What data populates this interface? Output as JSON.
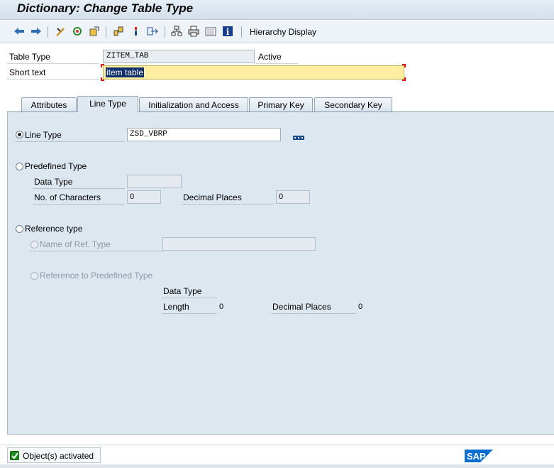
{
  "window": {
    "title": "Dictionary: Change Table Type"
  },
  "toolbar": {
    "icons": [
      "back-icon",
      "forward-icon",
      "display-change-icon",
      "activate-icon",
      "other-object-icon",
      "check-icon",
      "where-used-icon",
      "navigate-icon",
      "hierarchy-tree-icon",
      "print-icon",
      "list-icon",
      "info-icon"
    ],
    "hierarchy_display_label": "Hierarchy Display"
  },
  "header": {
    "table_type_label": "Table Type",
    "table_type_value": "ZITEM_TAB",
    "status": "Active",
    "short_text_label": "Short text",
    "short_text_value": "item table"
  },
  "tabs": [
    {
      "label": "Attributes",
      "active": false
    },
    {
      "label": "Line Type",
      "active": true
    },
    {
      "label": "Initialization and Access",
      "active": false
    },
    {
      "label": "Primary Key",
      "active": false
    },
    {
      "label": "Secondary Key",
      "active": false
    }
  ],
  "line_type": {
    "line_type_label": "Line Type",
    "line_type_value": "ZSD_VBRP",
    "predefined_type_label": "Predefined Type",
    "data_type_label": "Data Type",
    "data_type_value": "",
    "no_of_characters_label": "No. of Characters",
    "no_of_characters_value": "0",
    "decimal_places_label": "Decimal Places",
    "decimal_places_value": "0",
    "reference_type_label": "Reference type",
    "name_of_ref_type_label": "Name of Ref. Type",
    "name_of_ref_type_value": "",
    "reference_to_predefined_label": "Reference to Predefined Type",
    "ref_data_type_label": "Data Type",
    "ref_length_label": "Length",
    "ref_length_value": "0",
    "ref_decimal_places_label": "Decimal Places",
    "ref_decimal_places_value": "0",
    "selected_option": "Line Type"
  },
  "status_bar": {
    "message": "Object(s) activated",
    "logo_text": "SAP"
  },
  "colors": {
    "panel_bg": "#dde7f0",
    "required_field_bg": "#ffee9f",
    "selection_bg": "#0f2f6e",
    "success_green": "#1d8b1d",
    "sap_blue": "#0a6ed1"
  }
}
